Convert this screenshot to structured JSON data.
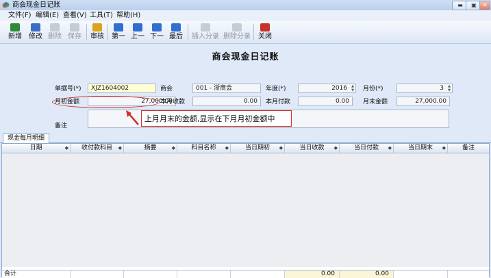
{
  "window": {
    "title": "商会现金日记账"
  },
  "menu": [
    {
      "label": "文件(F)"
    },
    {
      "label": "编辑(E)"
    },
    {
      "label": "查看(V)"
    },
    {
      "label": "工具(T)"
    },
    {
      "label": "帮助(H)"
    }
  ],
  "toolbar": [
    {
      "label": "新增",
      "icon": "new-doc-icon",
      "enabled": true,
      "color": "#2f8a3a"
    },
    {
      "label": "修改",
      "icon": "edit-icon",
      "enabled": true,
      "color": "#3b6fc4"
    },
    {
      "label": "删除",
      "icon": "delete-icon",
      "enabled": false,
      "color": "#9aa3ad"
    },
    {
      "label": "保存",
      "icon": "save-icon",
      "enabled": false,
      "color": "#9aa3ad"
    },
    {
      "label": "审核",
      "icon": "audit-icon",
      "enabled": true,
      "color": "#d9a21f"
    },
    {
      "label": "第一",
      "icon": "first-icon",
      "enabled": true,
      "color": "#2e6fd0"
    },
    {
      "label": "上一",
      "icon": "prev-icon",
      "enabled": true,
      "color": "#2e6fd0"
    },
    {
      "label": "下一",
      "icon": "next-icon",
      "enabled": true,
      "color": "#2e6fd0"
    },
    {
      "label": "最后",
      "icon": "last-icon",
      "enabled": true,
      "color": "#2e6fd0"
    },
    {
      "label": "插入分录",
      "icon": "insert-entry-icon",
      "enabled": false,
      "color": "#9aa3ad"
    },
    {
      "label": "删除分录",
      "icon": "delete-entry-icon",
      "enabled": false,
      "color": "#9aa3ad"
    },
    {
      "label": "关闭",
      "icon": "close-icon",
      "enabled": true,
      "color": "#c9302c"
    }
  ],
  "form": {
    "title": "商会现金日记账",
    "doc_no_label": "单据号(*)",
    "doc_no_value": "XJZ1604002",
    "chamber_label": "商会",
    "chamber_value": "001 - 浙商会",
    "year_label": "年度(*)",
    "year_value": "2016",
    "month_label": "月份(*)",
    "month_value": "3",
    "opening_label": "月初金额",
    "opening_value": "27,000.00",
    "month_income_label": "本月收款",
    "month_income_value": "0.00",
    "month_payment_label": "本月付款",
    "month_payment_value": "0.00",
    "closing_label": "月末金额",
    "closing_value": "27,000.00",
    "remark_label": "备注",
    "remark_value": ""
  },
  "annotation": {
    "text": "上月月末的金额,显示在下月月初金额中",
    "color": "#d23030"
  },
  "tabs": [
    {
      "label": "现金每月明细"
    }
  ],
  "grid": {
    "columns": [
      "日期",
      "收付款科目",
      "摘要",
      "科目名称",
      "当日期初",
      "当日收款",
      "当日付款",
      "当日期末",
      "备注"
    ],
    "footer": {
      "label": "合计",
      "income_total": "0.00",
      "payment_total": "0.00"
    }
  }
}
